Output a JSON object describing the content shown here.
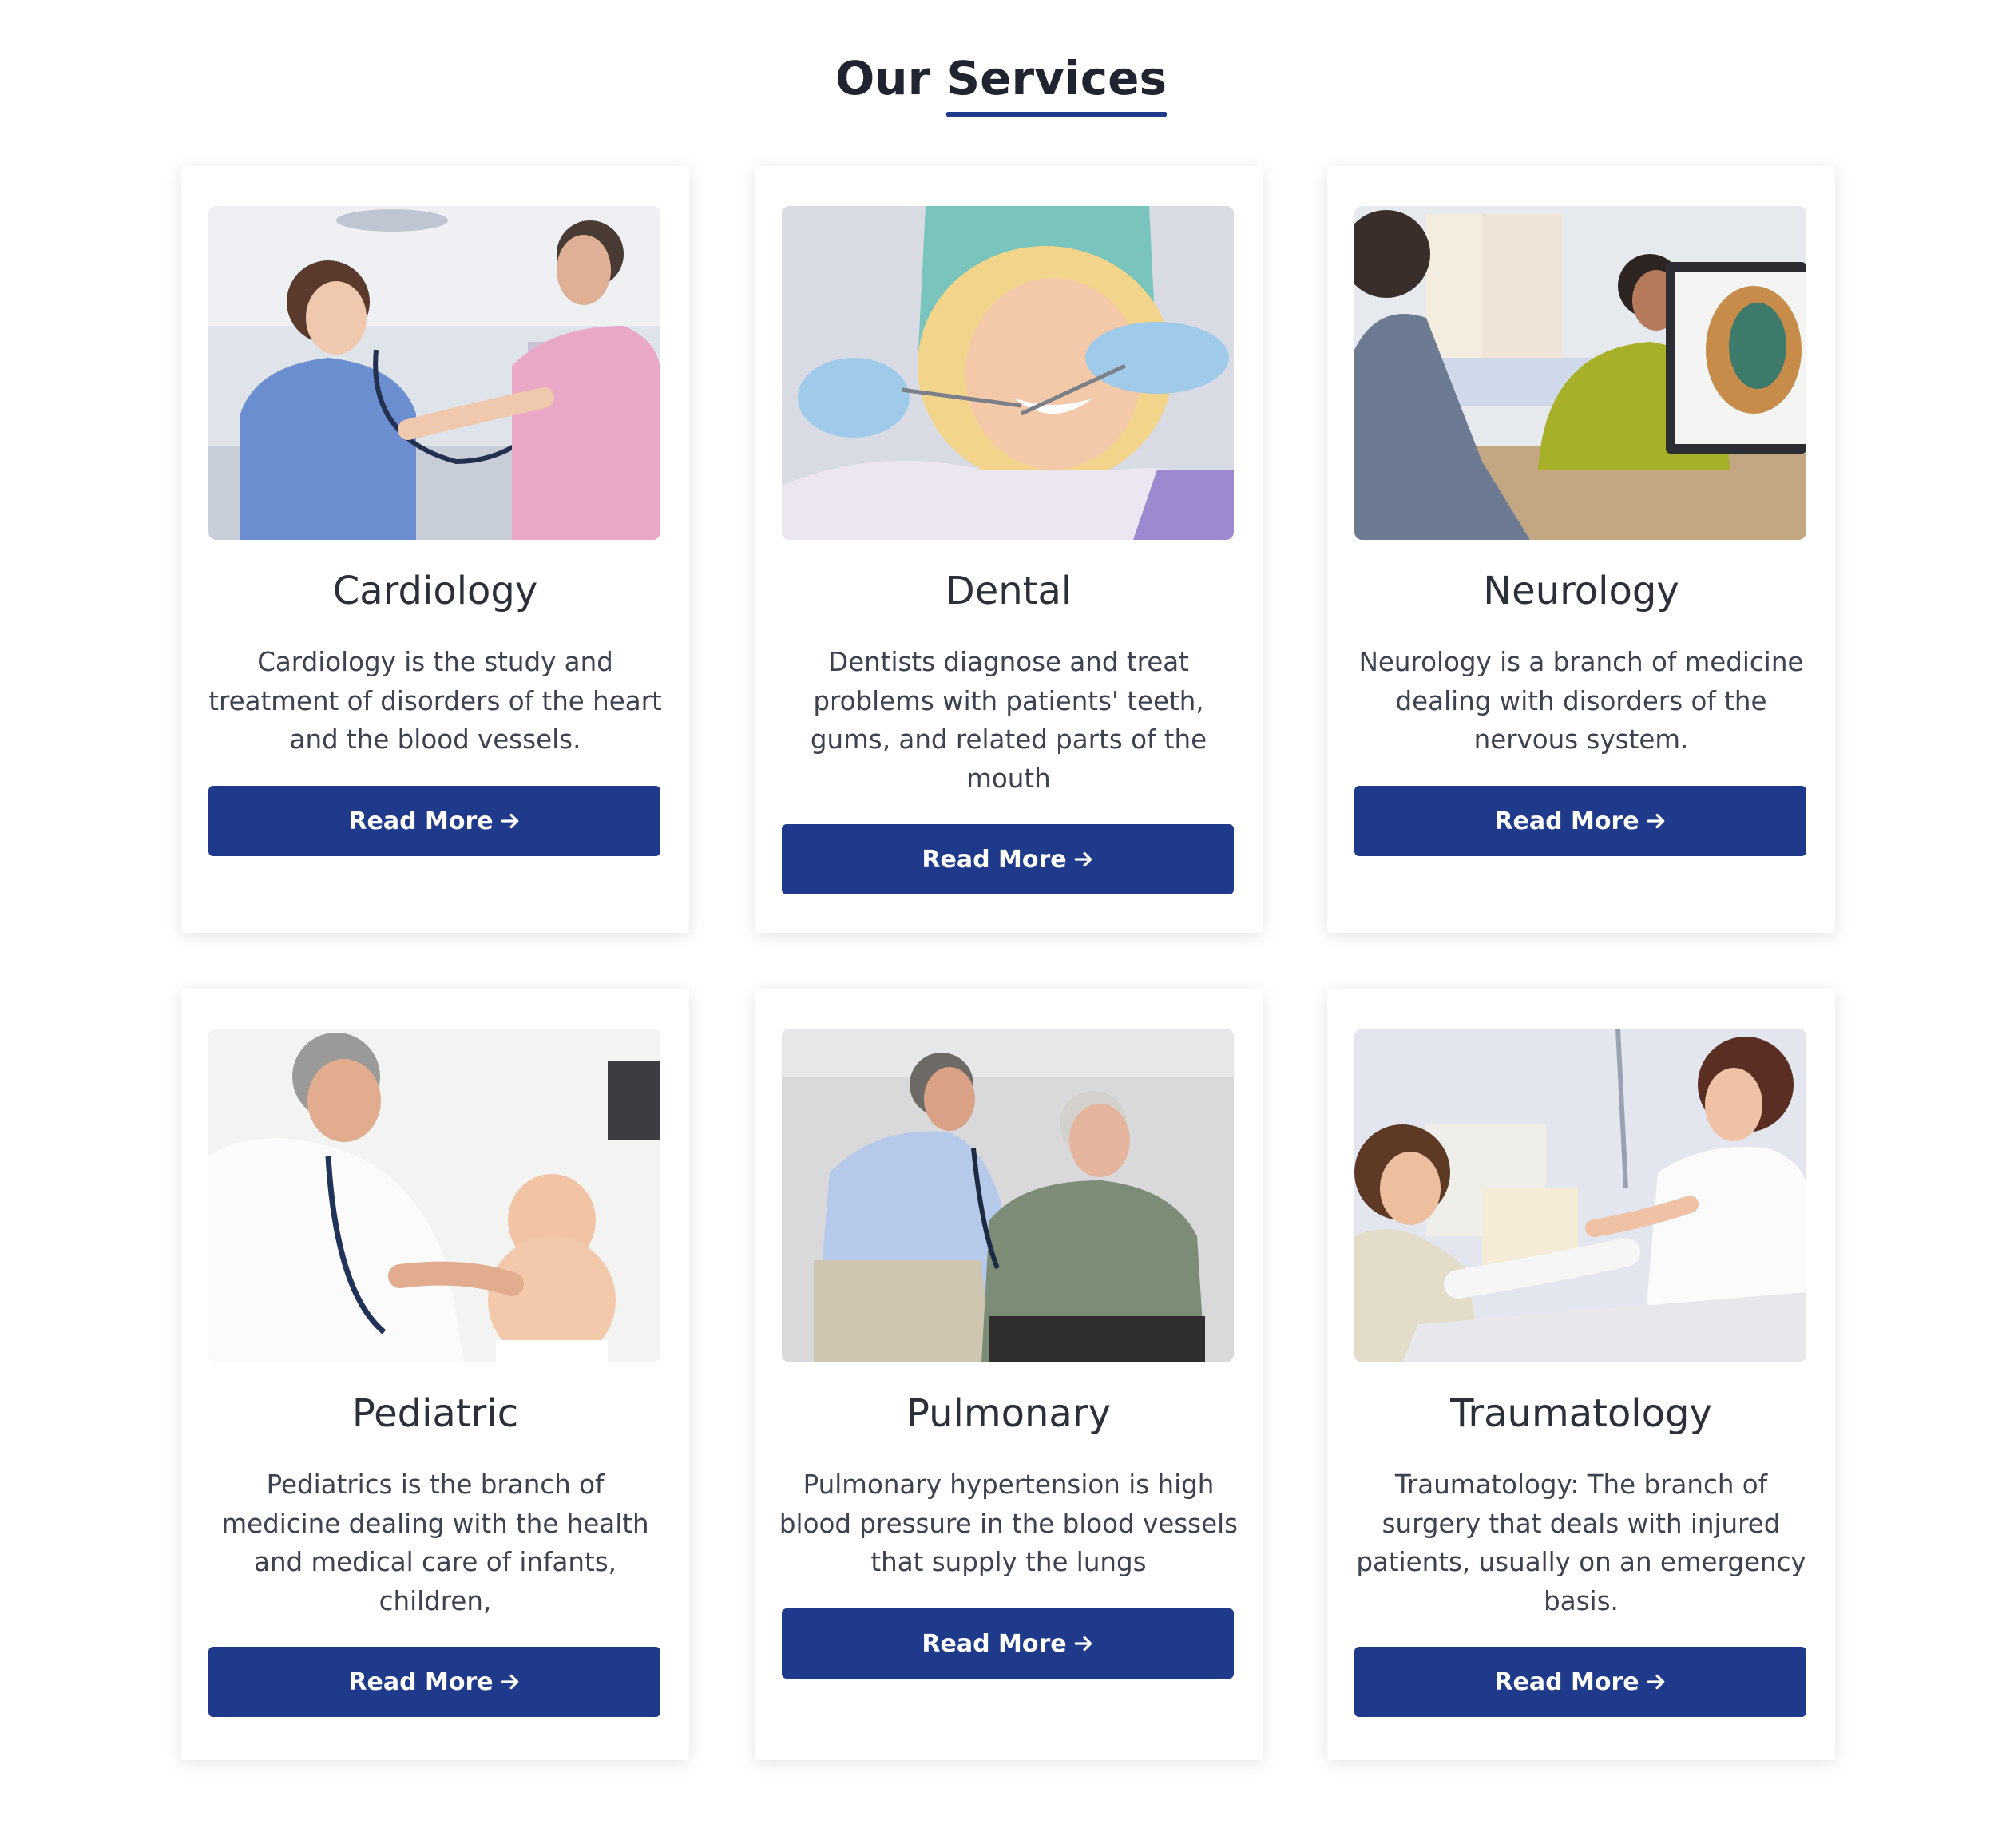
{
  "section": {
    "title_part1": "Our",
    "title_part2": "Services",
    "accent_color": "#1f3a8a"
  },
  "services": [
    {
      "title": "Cardiology",
      "description": "Cardiology is the study and treatment of disorders of the heart and the blood vessels.",
      "button_label": "Read More",
      "button_icon": "arrow-right-icon",
      "image": "nurse-listening-to-patient-heart-photo"
    },
    {
      "title": "Dental",
      "description": "Dentists diagnose and treat problems with patients' teeth, gums, and related parts of the mouth",
      "button_label": "Read More",
      "button_icon": "arrow-right-icon",
      "image": "smiling-dental-patient-photo"
    },
    {
      "title": "Neurology",
      "description": "Neurology is a branch of medicine dealing with disorders of the nervous system.",
      "button_label": "Read More",
      "button_icon": "arrow-right-icon",
      "image": "doctor-with-brain-scan-monitor-photo"
    },
    {
      "title": "Pediatric",
      "description": "Pediatrics is the branch of medicine dealing with the health and medical care of infants, children,",
      "button_label": "Read More",
      "button_icon": "arrow-right-icon",
      "image": "doctor-examining-baby-photo"
    },
    {
      "title": "Pulmonary",
      "description": "Pulmonary hypertension is high blood pressure in the blood vessels that supply the lungs",
      "button_label": "Read More",
      "button_icon": "arrow-right-icon",
      "image": "doctor-listening-to-elderly-patient-photo"
    },
    {
      "title": "Traumatology",
      "description": "Traumatology: The branch of surgery that deals with injured patients, usually on an emergency basis.",
      "button_label": "Read More",
      "button_icon": "arrow-right-icon",
      "image": "nurse-bandaging-arm-photo"
    }
  ]
}
